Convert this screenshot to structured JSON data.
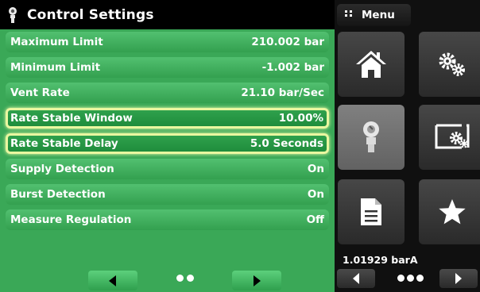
{
  "header": {
    "title": "Control Settings",
    "icon": "pressure-regulator-icon"
  },
  "rows": [
    {
      "label": "Maximum Limit",
      "value": "210.002 bar",
      "highlighted": false
    },
    {
      "label": "Minimum Limit",
      "value": "-1.002 bar",
      "highlighted": false
    },
    {
      "label": "Vent Rate",
      "value": "21.10 bar/Sec",
      "highlighted": false
    },
    {
      "label": "Rate Stable Window",
      "value": "10.00%",
      "highlighted": true
    },
    {
      "label": "Rate Stable Delay",
      "value": "5.0 Seconds",
      "highlighted": true
    },
    {
      "label": "Supply Detection",
      "value": "On",
      "highlighted": false
    },
    {
      "label": "Burst Detection",
      "value": "On",
      "highlighted": false
    },
    {
      "label": "Measure Regulation",
      "value": "Off",
      "highlighted": false
    }
  ],
  "left_footer": {
    "prev_icon": "left-arrow-icon",
    "next_icon": "right-arrow-icon",
    "page_dots": 2
  },
  "sidebar": {
    "menu_label": "Menu",
    "menu_icon": "grid-icon",
    "tiles": [
      {
        "name": "home",
        "icon": "home-icon"
      },
      {
        "name": "settings",
        "icon": "gears-icon"
      },
      {
        "name": "control",
        "icon": "pressure-regulator-icon",
        "active": true
      },
      {
        "name": "display-settings",
        "icon": "monitor-gear-icon"
      },
      {
        "name": "documents",
        "icon": "document-icon"
      },
      {
        "name": "favorites",
        "icon": "star-icon"
      }
    ],
    "reading": "1.01929 barA",
    "page_dots": 3
  },
  "colors": {
    "green": "#3aa857",
    "highlight_border": "#e9f7a0",
    "sidebar": "#101010"
  }
}
